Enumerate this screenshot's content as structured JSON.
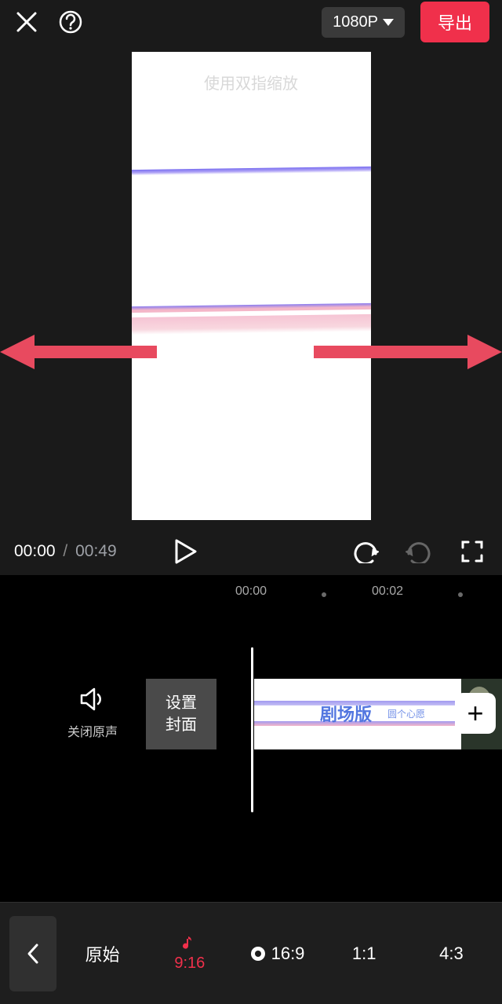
{
  "topbar": {
    "resolution_label": "1080P",
    "export_label": "导出"
  },
  "preview": {
    "hint_text": "使用双指缩放"
  },
  "playback": {
    "current_time": "00:00",
    "separator": "/",
    "duration": "00:49"
  },
  "ruler": {
    "marks": [
      "00:00",
      "00:02"
    ]
  },
  "timeline": {
    "mute_label": "关闭原声",
    "cover_line1": "设置",
    "cover_line2": "封面",
    "clip_text_main": "剧场版",
    "clip_text_sub": "圆个心愿",
    "add_clip_symbol": "+"
  },
  "ratios": {
    "items": [
      {
        "label": "原始"
      },
      {
        "label": "9:16",
        "active": true,
        "has_icon": true
      },
      {
        "label": "16:9",
        "has_icon": true,
        "icon_type": "circle"
      },
      {
        "label": "1:1"
      },
      {
        "label": "4:3"
      }
    ]
  }
}
